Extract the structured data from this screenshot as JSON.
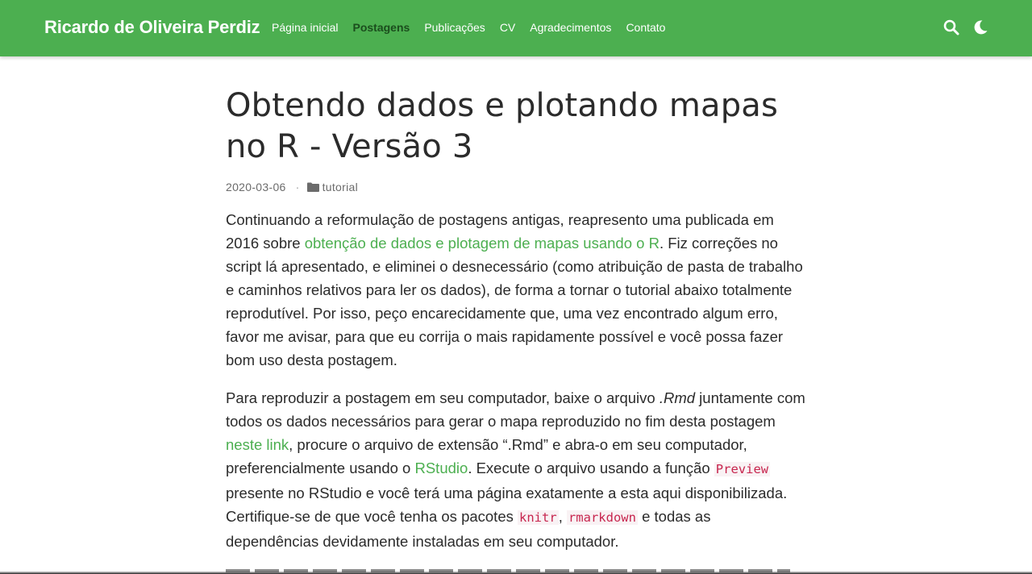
{
  "navbar": {
    "brand": "Ricardo de Oliveira Perdiz",
    "links": [
      {
        "label": "Página inicial",
        "active": false
      },
      {
        "label": "Postagens",
        "active": true
      },
      {
        "label": "Publicações",
        "active": false
      },
      {
        "label": "CV",
        "active": false
      },
      {
        "label": "Agradecimentos",
        "active": false
      },
      {
        "label": "Contato",
        "active": false
      }
    ],
    "icons": [
      "search-icon",
      "moon-icon"
    ],
    "color": "#4caf50"
  },
  "post": {
    "title": "Obtendo dados e plotando mapas no R - Versão 3",
    "date": "2020-03-06",
    "separator": "·",
    "category_icon": "folder-icon",
    "category": "tutorial",
    "p1": {
      "t1": "Continuando a reformulação de postagens antigas, reapresento uma publicada em 2016 sobre ",
      "link": "obtenção de dados e plotagem de mapas usando o R",
      "t2": ". Fiz correções no script lá apresentado, e eliminei o desnecessário (como atribuição de pasta de trabalho e caminhos relativos para ler os dados), de forma a tornar o tutorial abaixo totalmente reprodutível. Por isso, peço encarecidamente que, uma vez encontrado algum erro, favor me avisar, para que eu corrija o mais rapidamente possível e você possa fazer bom uso desta postagem."
    },
    "p2": {
      "t1": "Para reproduzir a postagem em seu computador, baixe o arquivo ",
      "ital": ".Rmd",
      "t2": " juntamente com todos os dados necessários para gerar o mapa reproduzido no fim desta postagem ",
      "link1": "neste link",
      "t3": ", procure o arquivo de extensão “.Rmd” e abra-o em seu computador, preferencialmente usando o ",
      "link2": "RStudio",
      "t4": ". Execute o arquivo usando a função ",
      "code1": "Preview",
      "t5": " presente no RStudio e você terá uma página exatamente a esta aqui disponibilizada. Certifique-se de que você tenha os pacotes ",
      "code2": "knitr",
      "t6": ", ",
      "code3": "rmarkdown",
      "t7": " e todas as dependências devidamente instaladas em seu computador."
    }
  }
}
